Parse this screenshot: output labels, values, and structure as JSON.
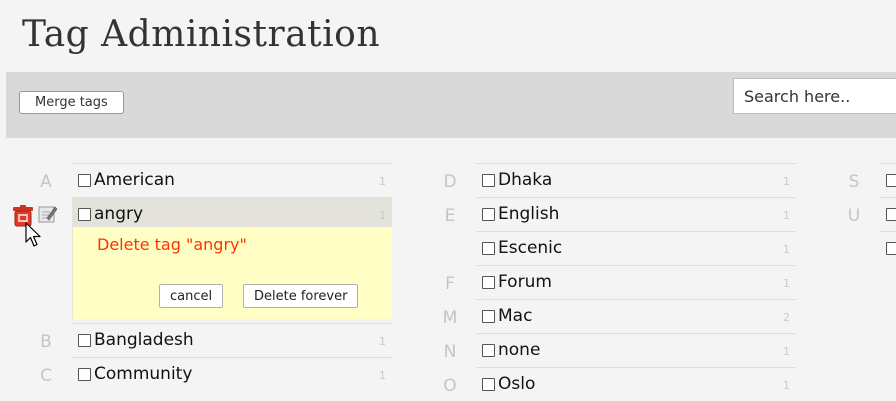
{
  "header": {
    "title": "Tag Administration"
  },
  "toolbar": {
    "merge_label": "Merge tags",
    "search_placeholder": "Search here.."
  },
  "columns": [
    {
      "rows": [
        {
          "letter": "A",
          "name": "American",
          "count": "1"
        },
        {
          "letter": "",
          "name": "angry",
          "count": "1"
        },
        {
          "letter": "B",
          "name": "Bangladesh",
          "count": "1"
        },
        {
          "letter": "C",
          "name": "Community",
          "count": "1"
        }
      ]
    },
    {
      "rows": [
        {
          "letter": "D",
          "name": "Dhaka",
          "count": "1"
        },
        {
          "letter": "E",
          "name": "English",
          "count": "1"
        },
        {
          "letter": "",
          "name": "Escenic",
          "count": "1"
        },
        {
          "letter": "F",
          "name": "Forum",
          "count": "1"
        },
        {
          "letter": "M",
          "name": "Mac",
          "count": "2"
        },
        {
          "letter": "N",
          "name": "none",
          "count": "1"
        },
        {
          "letter": "O",
          "name": "Oslo",
          "count": "1"
        }
      ]
    },
    {
      "rows": [
        {
          "letter": "S"
        },
        {
          "letter": "U"
        },
        {
          "letter": ""
        }
      ]
    }
  ],
  "delete_panel": {
    "message": "Delete tag \"angry\"",
    "cancel_label": "cancel",
    "confirm_label": "Delete forever"
  },
  "icons": {
    "trash": "trash-icon",
    "edit": "edit-icon",
    "cursor": "mouse-pointer-icon"
  },
  "colors": {
    "delete_panel_bg": "#ffffc5",
    "delete_message": "#ff3300",
    "trash_icon": "#cc3322",
    "selected_row_bg": "#e3e3db"
  }
}
